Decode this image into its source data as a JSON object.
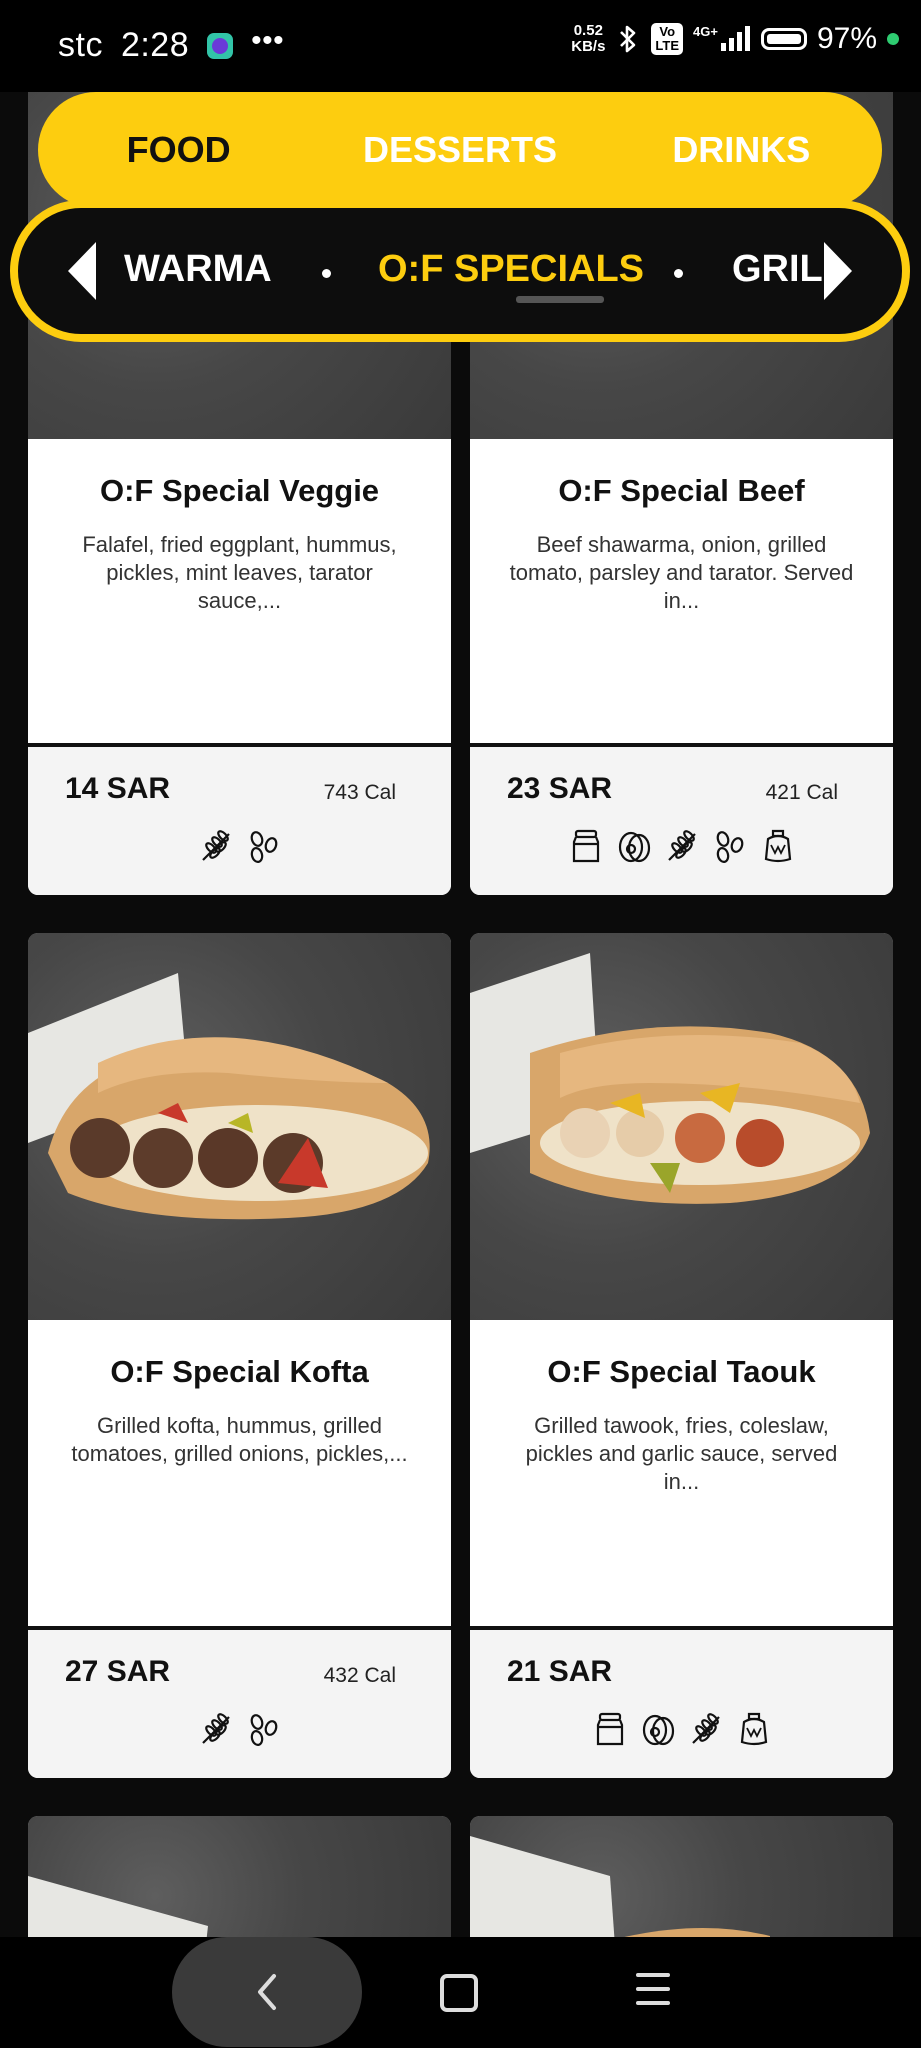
{
  "status_bar": {
    "carrier": "stc",
    "time": "2:28",
    "dots": "•••",
    "net_speed_value": "0.52",
    "net_speed_unit": "KB/s",
    "volte_top": "Vo",
    "volte_bottom": "LTE",
    "signal_type": "4G+",
    "battery": "97%"
  },
  "category_tabs": [
    {
      "label": "FOOD",
      "active": true
    },
    {
      "label": "DESSERTS",
      "active": false
    },
    {
      "label": "DRINKS",
      "active": false
    }
  ],
  "subcategories": {
    "prev_partial": "WARMA",
    "active": "O:F SPECIALS",
    "next_partial": "GRIL"
  },
  "products": [
    {
      "title": "O:F Special Veggie",
      "description": "Falafel, fried eggplant, hummus, pickles, mint leaves, tarator sauce,...",
      "price": "14 SAR",
      "calories": "743 Cal",
      "allergens": [
        "wheat-icon",
        "sesame-icon"
      ]
    },
    {
      "title": "O:F Special Beef",
      "description": "Beef shawarma, onion, grilled tomato, parsley and tarator. Served in...",
      "price": "23 SAR",
      "calories": "421 Cal",
      "allergens": [
        "milk-icon",
        "egg-icon",
        "wheat-icon",
        "sesame-icon",
        "mustard-icon"
      ]
    },
    {
      "title": "O:F Special Kofta",
      "description": "Grilled kofta, hummus, grilled tomatoes, grilled onions, pickles,...",
      "price": "27 SAR",
      "calories": "432 Cal",
      "allergens": [
        "wheat-icon",
        "sesame-icon"
      ]
    },
    {
      "title": "O:F Special Taouk",
      "description": "Grilled tawook, fries, coleslaw, pickles and garlic sauce, served in...",
      "price": "21 SAR",
      "calories": "",
      "allergens": [
        "milk-icon",
        "egg-icon",
        "wheat-icon",
        "mustard-icon"
      ]
    }
  ],
  "colors": {
    "accent": "#fdcd0f",
    "background": "#0b0b0b",
    "card": "#ffffff",
    "card_footer": "#f4f4f4"
  },
  "nav_bar": {
    "back": "chevron-left-icon",
    "home": "square-icon",
    "menu": "menu-icon"
  }
}
